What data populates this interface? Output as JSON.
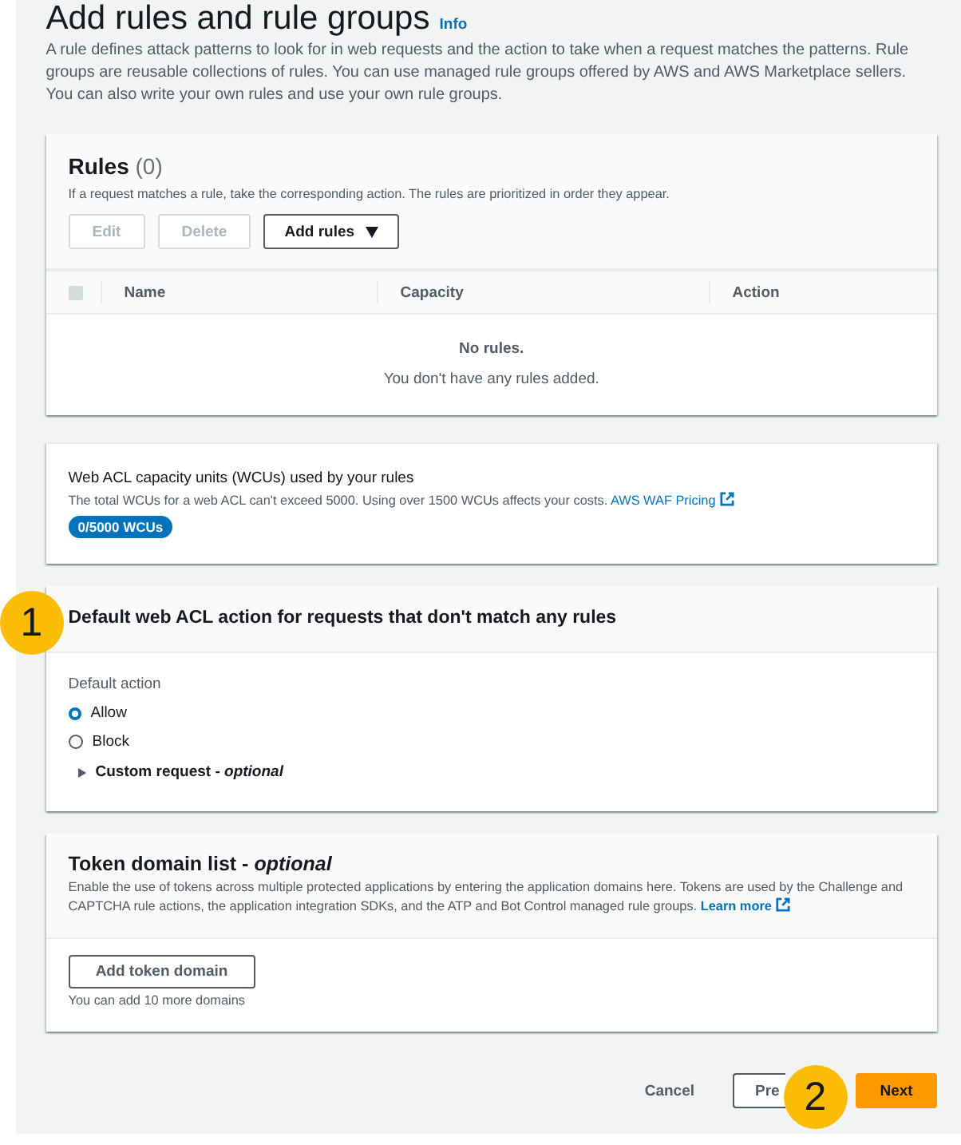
{
  "page": {
    "title": "Add rules and rule groups",
    "info_link": "Info",
    "description": "A rule defines attack patterns to look for in web requests and the action to take when a request matches the patterns. Rule groups are reusable collections of rules. You can use managed rule groups offered by AWS and AWS Marketplace sellers. You can also write your own rules and use your own rule groups."
  },
  "rules": {
    "title": "Rules",
    "count": "(0)",
    "description": "If a request matches a rule, take the corresponding action. The rules are prioritized in order they appear.",
    "buttons": [
      {
        "label": "Edit",
        "disabled": true,
        "kind": "plain"
      },
      {
        "label": "Delete",
        "disabled": true,
        "kind": "plain"
      },
      {
        "label": "Add rules",
        "disabled": false,
        "kind": "dropdown"
      }
    ],
    "table": {
      "select_all_checked": false,
      "columns": [
        "Name",
        "Capacity",
        "Action"
      ],
      "empty_title": "No rules.",
      "empty_text": "You don't have any rules added."
    }
  },
  "capacity": {
    "title": "Web ACL capacity units (WCUs) used by your rules",
    "description": "The total WCUs for a web ACL can't exceed 5000. Using over 1500 WCUs affects your costs.",
    "link": "AWS WAF Pricing",
    "badge": "0/5000 WCUs"
  },
  "default_action": {
    "title": "Default web ACL action for requests that don't match any rules",
    "label": "Default action",
    "options": [
      {
        "label": "Allow",
        "selected": true
      },
      {
        "label": "Block",
        "selected": false
      }
    ],
    "custom_request": {
      "label": "Custom request - *optional*",
      "expanded": false
    }
  },
  "token_domains": {
    "title": "Token domain list - *optional*",
    "description": "Enable the use of tokens across multiple protected applications by entering the application domains here. Tokens are used by the Challenge and CAPTCHA rule actions, the application integration SDKs, and the ATP and Bot Control managed rule groups.",
    "link": "Learn more",
    "button": "Add token domain",
    "hint": "You can add 10 more domains"
  },
  "footer": {
    "cancel": "Cancel",
    "previous": "Pre",
    "next": "Next"
  },
  "callouts": [
    "1",
    "2"
  ]
}
